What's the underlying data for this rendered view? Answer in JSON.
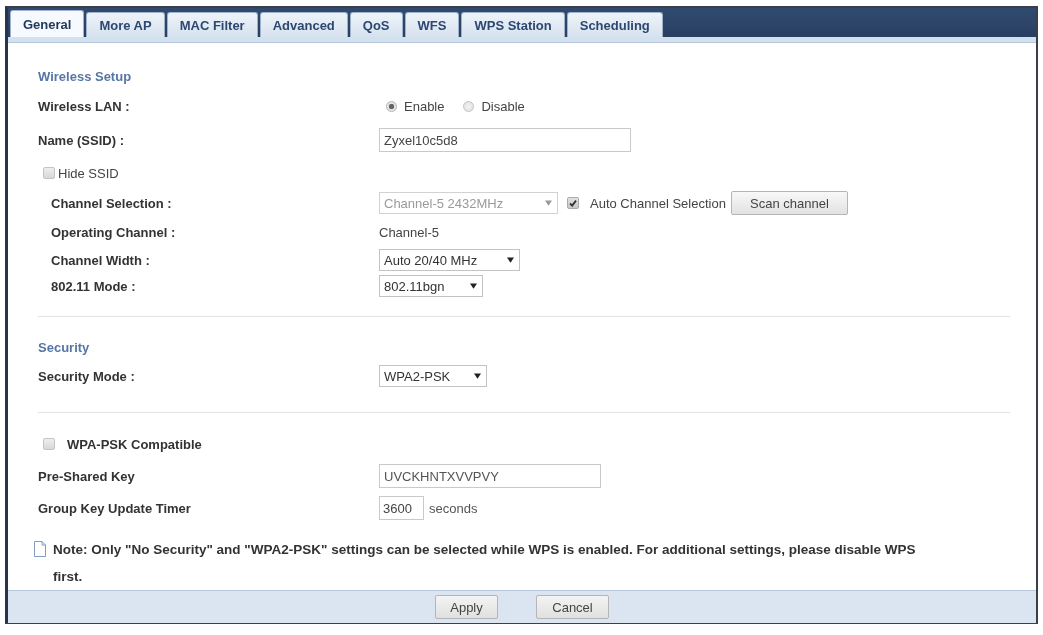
{
  "tabs": [
    {
      "label": "General",
      "selected": true
    },
    {
      "label": "More AP",
      "selected": false
    },
    {
      "label": "MAC Filter",
      "selected": false
    },
    {
      "label": "Advanced",
      "selected": false
    },
    {
      "label": "QoS",
      "selected": false
    },
    {
      "label": "WFS",
      "selected": false
    },
    {
      "label": "WPS Station",
      "selected": false
    },
    {
      "label": "Scheduling",
      "selected": false
    }
  ],
  "wireless_setup": {
    "heading": "Wireless Setup",
    "wireless_lan": {
      "label": "Wireless LAN :",
      "options": [
        {
          "label": "Enable",
          "selected": true
        },
        {
          "label": "Disable",
          "selected": false
        }
      ]
    },
    "name_ssid": {
      "label": "Name (SSID) :",
      "value": "Zyxel10c5d8"
    },
    "hide_ssid": {
      "label": "Hide SSID",
      "checked": false
    },
    "channel_selection": {
      "label": "Channel Selection :",
      "value": "Channel-5 2432MHz",
      "disabled": true,
      "auto_channel": {
        "label": "Auto Channel Selection",
        "checked": true
      },
      "scan_button": "Scan channel"
    },
    "operating_channel": {
      "label": "Operating Channel :",
      "value": "Channel-5"
    },
    "channel_width": {
      "label": "Channel Width :",
      "value": "Auto 20/40 MHz",
      "disabled": false
    },
    "mode": {
      "label": "802.11 Mode :",
      "value": "802.11bgn",
      "disabled": false
    }
  },
  "security": {
    "heading": "Security",
    "security_mode": {
      "label": "Security Mode :",
      "value": "WPA2-PSK",
      "disabled": false
    },
    "wpa_psk_compatible": {
      "label": "WPA-PSK Compatible",
      "checked": false
    },
    "pre_shared_key": {
      "label": "Pre-Shared Key",
      "value": "UVCKHNTXVVPVY"
    },
    "group_key_update_timer": {
      "label": "Group Key Update Timer",
      "value": "3600",
      "unit": "seconds"
    }
  },
  "note": "Note: Only \"No Security\" and \"WPA2-PSK\" settings can be selected while WPS is enabled. For additional settings, please disable WPS first.",
  "buttons": [
    "Apply",
    "Cancel"
  ]
}
